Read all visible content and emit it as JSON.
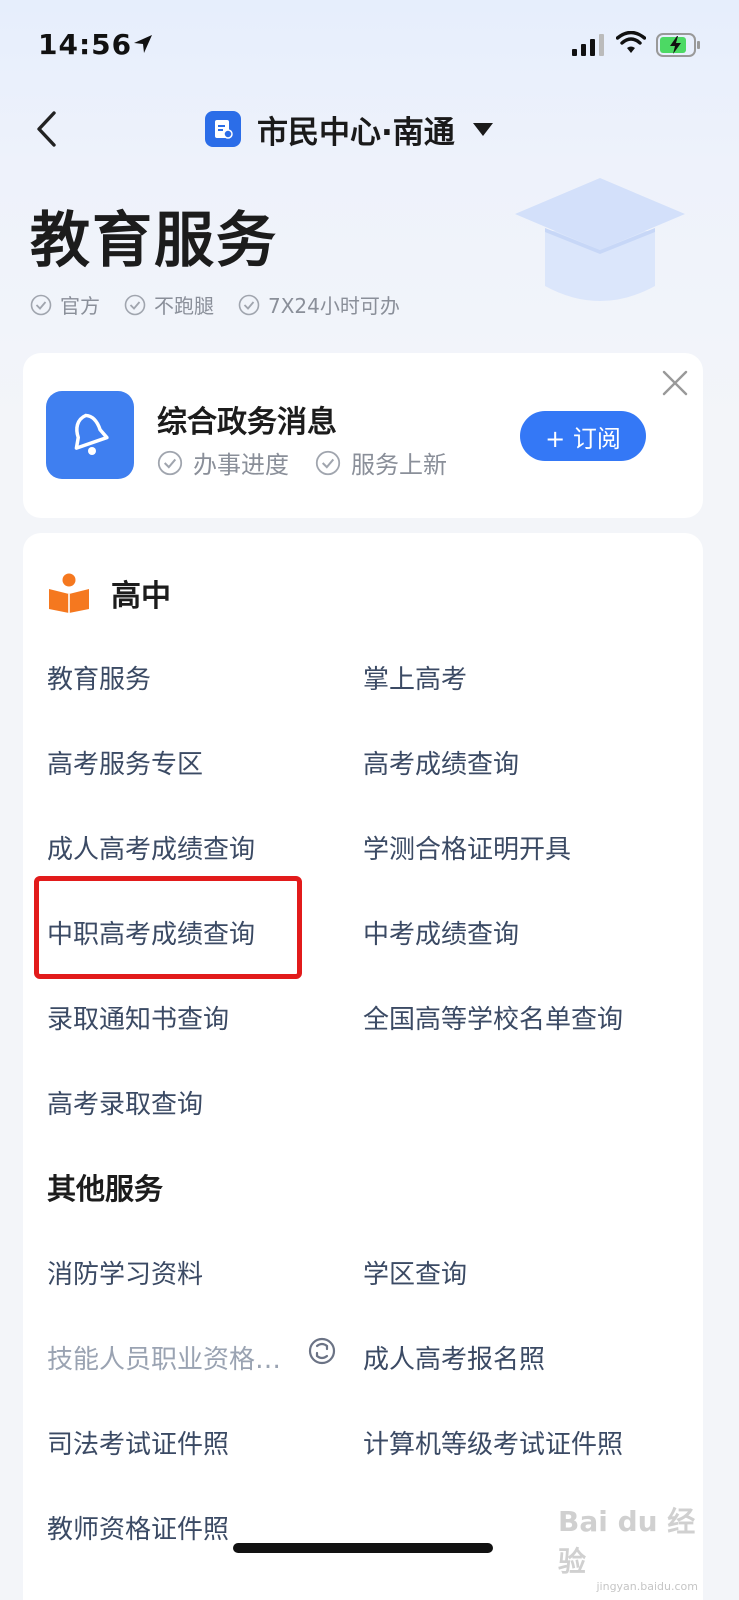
{
  "status_bar": {
    "time": "14:56"
  },
  "nav": {
    "title": "市民中心·南通"
  },
  "hero": {
    "title": "教育服务",
    "tags": [
      "官方",
      "不跑腿",
      "7X24小时可办"
    ]
  },
  "notice": {
    "title": "综合政务消息",
    "tags": [
      "办事进度",
      "服务上新"
    ],
    "subscribe_label": "+ 订阅"
  },
  "section": {
    "title": "高中",
    "items": [
      "教育服务",
      "掌上高考",
      "高考服务专区",
      "高考成绩查询",
      "成人高考成绩查询",
      "学测合格证明开具",
      "中职高考成绩查询",
      "中考成绩查询",
      "录取通知书查询",
      "全国高等学校名单查询",
      "高考录取查询"
    ]
  },
  "other": {
    "title": "其他服务",
    "items": [
      "消防学习资料",
      "学区查询",
      "技能人员职业资格…",
      "成人高考报名照",
      "司法考试证件照",
      "计算机等级考试证件照",
      "教师资格证件照"
    ]
  },
  "watermark": {
    "main": "Bai du 经验",
    "sub": "jingyan.baidu.com"
  },
  "colors": {
    "accent": "#3478f6",
    "highlight": "#e21b1b",
    "link": "#3b4a64"
  }
}
